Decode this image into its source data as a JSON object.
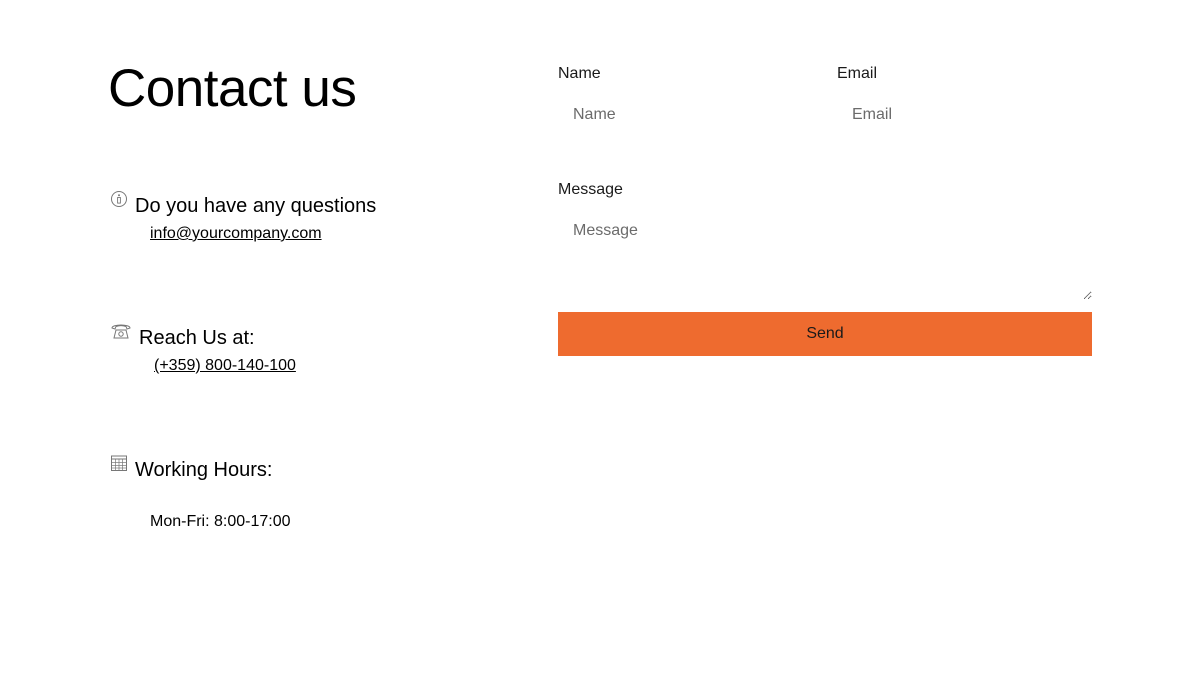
{
  "page": {
    "title": "Contact us"
  },
  "contact": {
    "questions": {
      "icon": "info-icon",
      "label": "Do you have any questions",
      "email": "info@yourcompany.com"
    },
    "reach": {
      "icon": "telephone-icon",
      "label": "Reach Us at:",
      "phone": "(+359) 800-140-100"
    },
    "hours": {
      "icon": "calendar-icon",
      "label": "Working Hours:",
      "value": "Mon-Fri: 8:00-17:00"
    }
  },
  "form": {
    "name_label": "Name",
    "name_placeholder": "Name",
    "email_label": "Email",
    "email_placeholder": "Email",
    "message_label": "Message",
    "message_placeholder": "Message",
    "send_label": "Send"
  },
  "colors": {
    "accent": "#ee6b2f"
  }
}
